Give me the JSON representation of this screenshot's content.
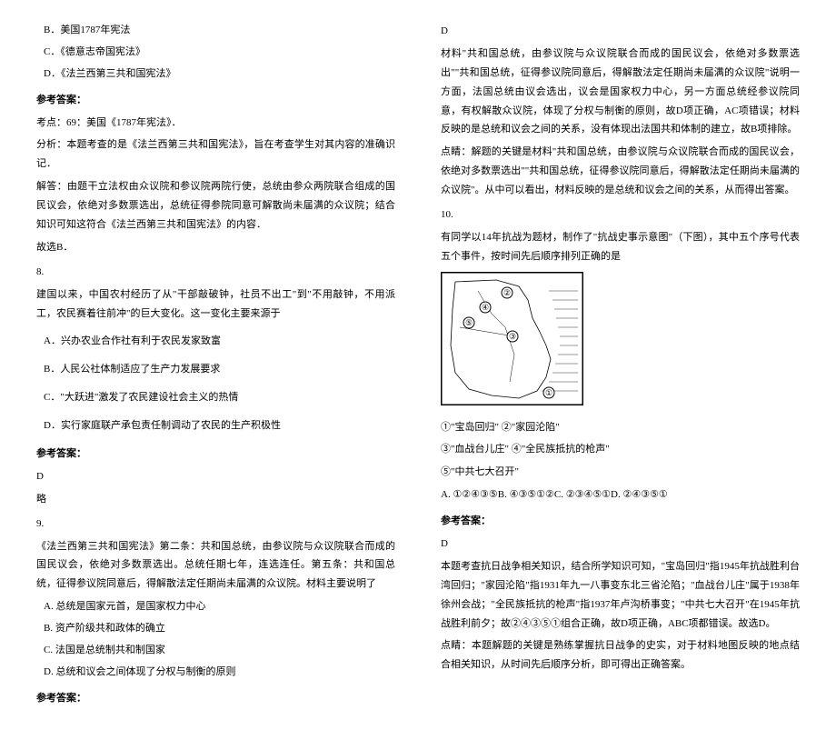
{
  "left": {
    "optB": "B．美国1787年宪法",
    "optC": "C．《德意志帝国宪法》",
    "optD": "D．《法兰西第三共和国宪法》",
    "answerHeading": "参考答案：",
    "point": "考点：69：美国《1787年宪法》．",
    "analysis": "分析：本题考查的是《法兰西第三共和国宪法》，旨在考查学生对其内容的准确识记．",
    "solution": "解答：由题干立法权由众议院和参议院两院行使，总统由参众两院联合组成的国民议会，依绝对多数票选出，总统征得参院同意可解散尚未届满的众议院；结合知识可知这符合《法兰西第三共和国宪法》的内容．",
    "soChoose": "故选B．",
    "q8num": "8.",
    "q8text1": "建国以来，中国农村经历了从\"干部敲破钟，社员不出工\"到\"不用敲钟，不用派工，农民赛着往前冲\"的巨大变化。这一变化主要来源于",
    "q8a": "A．兴办农业合作社有利于农民发家致富",
    "q8b": "B．人民公社体制适应了生产力发展要求",
    "q8c": "C．\"大跃进\"激发了农民建设社会主义的热情",
    "q8d": "D．实行家庭联产承包责任制调动了农民的生产积极性",
    "q8answerHeading": "参考答案：",
    "q8answer": "D",
    "q8brief": "略",
    "q9num": "9.",
    "q9text": "《法兰西第三共和国宪法》第二条：共和国总统，由参议院与众议院联合而成的国民议会，依绝对多数票选出。总统任期七年，连选连任。第五条：共和国总统，征得参议院同意后，得解散法定任期尚未届满的众议院。材料主要说明了",
    "q9a": "A. 总统是国家元首，是国家权力中心",
    "q9b": "B. 资产阶级共和政体的确立",
    "q9c": "C. 法国是总统制共和制国家",
    "q9d": "D. 总统和议会之间体现了分权与制衡的原则",
    "q9answerHeading": "参考答案："
  },
  "right": {
    "q9answer": "D",
    "q9exp1": "材料\"共和国总统，由参议院与众议院联合而成的国民议会，依绝对多数票选出\"\"共和国总统，征得参议院同意后，得解散法定任期尚未届满的众议院\"说明一方面，法国总统由议会选出，议会是国家权力中心，另一方面总统经参议院同意，有权解散众议院，体现了分权与制衡的原则，故D项正确，AC项错误；材料反映的是总统和议会之间的关系，没有体现出法国共和体制的建立，故B项排除。",
    "q9exp2": "点睛：解题的关键是材料\"共和国总统，由参议院与众议院联合而成的国民议会，依绝对多数票选出\"\"共和国总统，征得参议院同意后，得解散法定任期尚未届满的众议院\"。从中可以看出，材料反映的是总统和议会之间的关系，从而得出答案。",
    "q10num": "10.",
    "q10text": "有同学以14年抗战为题材，制作了\"抗战史事示意图\"（下图），其中五个序号代表五个事件，按时间先后顺序排列正确的是",
    "q10opt1": "①\"宝岛回归\" ②\"家园沦陷\"",
    "q10opt2": "③\"血战台儿庄\" ④\"全民族抵抗的枪声\"",
    "q10opt3": "⑤\"中共七大召开\"",
    "q10choices": "A. ①②④③⑤B. ④③⑤①②C. ②③④⑤①D. ②④③⑤①",
    "q10answerHeading": "参考答案：",
    "q10answer": "D",
    "q10exp1": "本题考查抗日战争相关知识，结合所学知识可知，\"宝岛回归\"指1945年抗战胜利台湾回归；\"家园沦陷\"指1931年九一八事变东北三省沦陷；\"血战台儿庄\"属于1938年徐州会战；\"全民族抵抗的枪声\"指1937年卢沟桥事变；\"中共七大召开\"在1945年抗战胜利前夕；故②④③⑤①组合正确，故D项正确，ABC项都错误。故选D。",
    "q10exp2": "点睛：本题解题的关键是熟练掌握抗日战争的史实，对于材料地图反映的地点结合相关知识，从时间先后顺序分析，即可得出正确答案。"
  }
}
